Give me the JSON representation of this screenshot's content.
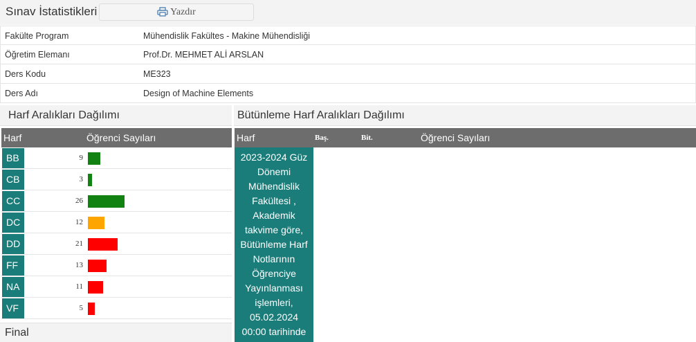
{
  "page": {
    "title": "Sınav İstatistikleri",
    "print_label": "Yazdır"
  },
  "info": [
    {
      "label": "Fakülte Program",
      "value": "Mühendislik Fakültes - Makine Mühendisliği"
    },
    {
      "label": "Öğretim Elemanı",
      "value": "Prof.Dr. MEHMET ALİ ARSLAN"
    },
    {
      "label": "Ders Kodu",
      "value": "ME323"
    },
    {
      "label": "Ders Adı",
      "value": "Design of Machine Elements"
    }
  ],
  "distribution": {
    "title": "Harf Aralıkları Dağılımı",
    "col_grade": "Harf",
    "col_count": "Öğrenci Sayıları",
    "rows": [
      {
        "grade": "BB",
        "count": "9",
        "value": 9,
        "color": "#128212"
      },
      {
        "grade": "CB",
        "count": "3",
        "value": 3,
        "color": "#128212"
      },
      {
        "grade": "CC",
        "count": "26",
        "value": 26,
        "color": "#128212"
      },
      {
        "grade": "DC",
        "count": "12",
        "value": 12,
        "color": "#ffa500"
      },
      {
        "grade": "DD",
        "count": "21",
        "value": 21,
        "color": "#ff0000"
      },
      {
        "grade": "FF",
        "count": "13",
        "value": 13,
        "color": "#ff0000"
      },
      {
        "grade": "NA",
        "count": "11",
        "value": 11,
        "color": "#ff0000"
      },
      {
        "grade": "VF",
        "count": "5",
        "value": 5,
        "color": "#ff0000"
      }
    ]
  },
  "makeup": {
    "title": "Bütünleme Harf Aralıkları Dağılımı",
    "col_grade": "Harf",
    "col_start": "Baş.",
    "col_end": "Bit.",
    "col_count": "Öğrenci Sayıları",
    "notice": "2023-2024 Güz\nDönemi\nMühendislik\nFakültesi ,\nAkademik\ntakvime göre,\nBütünleme Harf\nNotlarının\nÖğrenciye\nYayınlanması\nişlemleri,\n05.02.2024\n00:00 tarihinde"
  },
  "final": {
    "title": "Final"
  },
  "colors": {
    "teal": "#1a7d7a",
    "header_gray": "#6d6d6d"
  }
}
